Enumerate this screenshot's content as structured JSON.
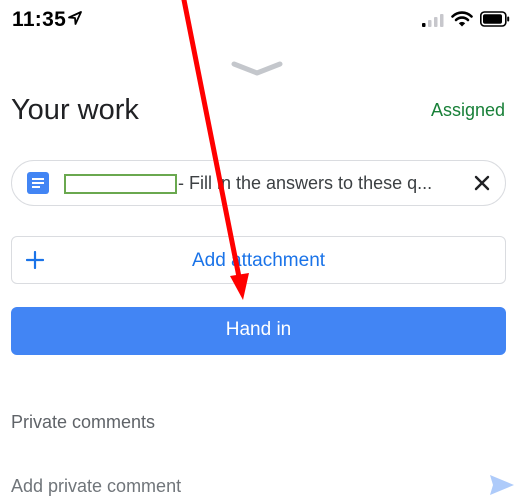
{
  "status_bar": {
    "time": "11:35"
  },
  "header": {
    "title": "Your work",
    "status": "Assigned"
  },
  "attachment": {
    "title": "- Fill in the answers to these q..."
  },
  "actions": {
    "add_attachment": "Add attachment",
    "hand_in": "Hand in"
  },
  "comments": {
    "heading": "Private comments",
    "placeholder": "Add private comment"
  },
  "colors": {
    "primary_blue": "#4285f4",
    "link_blue": "#1a73e8",
    "assigned_green": "#188038",
    "annotation_red": "#ff0000",
    "redaction_green": "#6aa84f"
  },
  "icons": [
    "location-arrow-icon",
    "signal-icon",
    "wifi-icon",
    "battery-icon",
    "chevron-down-icon",
    "document-icon",
    "close-icon",
    "plus-icon",
    "send-icon"
  ]
}
